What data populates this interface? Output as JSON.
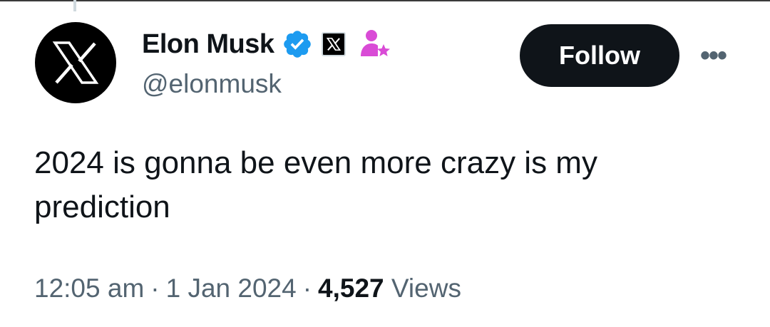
{
  "tweet": {
    "author": {
      "display_name": "Elon Musk",
      "handle": "@elonmusk",
      "avatar_icon": "x-logo-icon",
      "verified_icon": "verified-badge-icon",
      "verified_color": "#1d9bf0",
      "affiliation_icon": "x-affiliation-badge-icon",
      "extra_icon": "person-star-icon",
      "extra_icon_color": "#d94bd6"
    },
    "follow_label": "Follow",
    "more_label": "•••",
    "text": "2024 is gonna be even more crazy is my prediction",
    "time": "12:05 am",
    "separator": "·",
    "date": "1 Jan 2024",
    "views_count": "4,527",
    "views_label": "Views"
  }
}
